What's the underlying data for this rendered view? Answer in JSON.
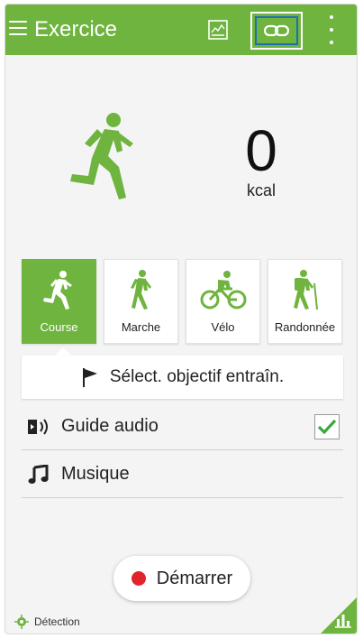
{
  "header": {
    "title": "Exercice",
    "icons": [
      "menu-icon",
      "chart-icon",
      "link-icon",
      "more-icon"
    ],
    "accent": "#6fb43f",
    "highlight_border": "#1c6fb5"
  },
  "calories": {
    "value": "0",
    "unit": "kcal"
  },
  "activities": [
    {
      "label": "Course",
      "icon": "runner-icon",
      "selected": true
    },
    {
      "label": "Marche",
      "icon": "walker-icon",
      "selected": false
    },
    {
      "label": "Vélo",
      "icon": "cyclist-icon",
      "selected": false
    },
    {
      "label": "Randonnée",
      "icon": "hiker-icon",
      "selected": false
    }
  ],
  "goal": {
    "label": "Sélect. objectif entraîn."
  },
  "options": {
    "audio_guide": {
      "label": "Guide audio",
      "checked": true
    },
    "music": {
      "label": "Musique"
    }
  },
  "start": {
    "label": "Démarrer",
    "dot_color": "#e0242c"
  },
  "footer": {
    "detection": "Détection"
  }
}
